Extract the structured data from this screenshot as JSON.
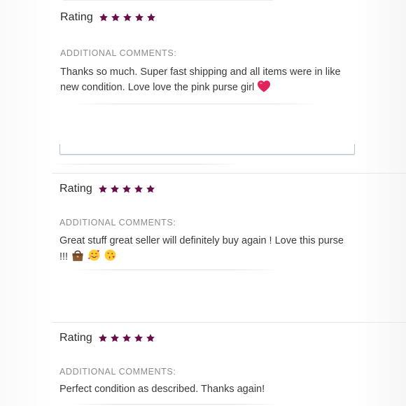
{
  "colors": {
    "star": "#6b0f4b",
    "heart": "#e0245e"
  },
  "reviews": [
    {
      "rating_label": "Rating",
      "stars": 5,
      "comments_label": "ADDITIONAL COMMENTS:",
      "comment_line1": "Thanks so much. Super fast shipping and all items were in like",
      "comment_line2": "new condition. Love love the pink purse girl",
      "emojis": [
        "red-heart"
      ]
    },
    {
      "rating_label": "Rating",
      "stars": 5,
      "comments_label": "ADDITIONAL COMMENTS:",
      "comment_line1": "Great stuff great seller will definitely buy again ! Love this purse",
      "comment_line2": "!!!",
      "emojis": [
        "handbag",
        "smiling-face-with-hearts",
        "face-blowing-kiss"
      ]
    },
    {
      "rating_label": "Rating",
      "stars": 5,
      "comments_label": "ADDITIONAL COMMENTS:",
      "comment_line1": "Perfect condition as described. Thanks again!"
    }
  ]
}
